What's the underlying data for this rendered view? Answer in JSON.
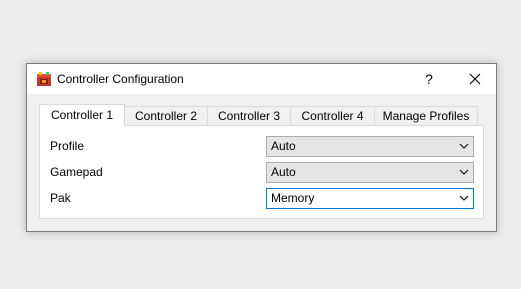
{
  "window": {
    "title": "Controller Configuration",
    "help_label": "?",
    "close_label": "✕"
  },
  "tabs": [
    {
      "label": "Controller 1",
      "active": true
    },
    {
      "label": "Controller 2",
      "active": false
    },
    {
      "label": "Controller 3",
      "active": false
    },
    {
      "label": "Controller 4",
      "active": false
    },
    {
      "label": "Manage Profiles",
      "active": false
    }
  ],
  "fields": [
    {
      "label": "Profile",
      "value": "Auto"
    },
    {
      "label": "Gamepad",
      "value": "Auto"
    },
    {
      "label": "Pak",
      "value": "Memory"
    }
  ],
  "colors": {
    "focus_border": "#0078d7",
    "combo_bg": "#e5e5e5"
  }
}
